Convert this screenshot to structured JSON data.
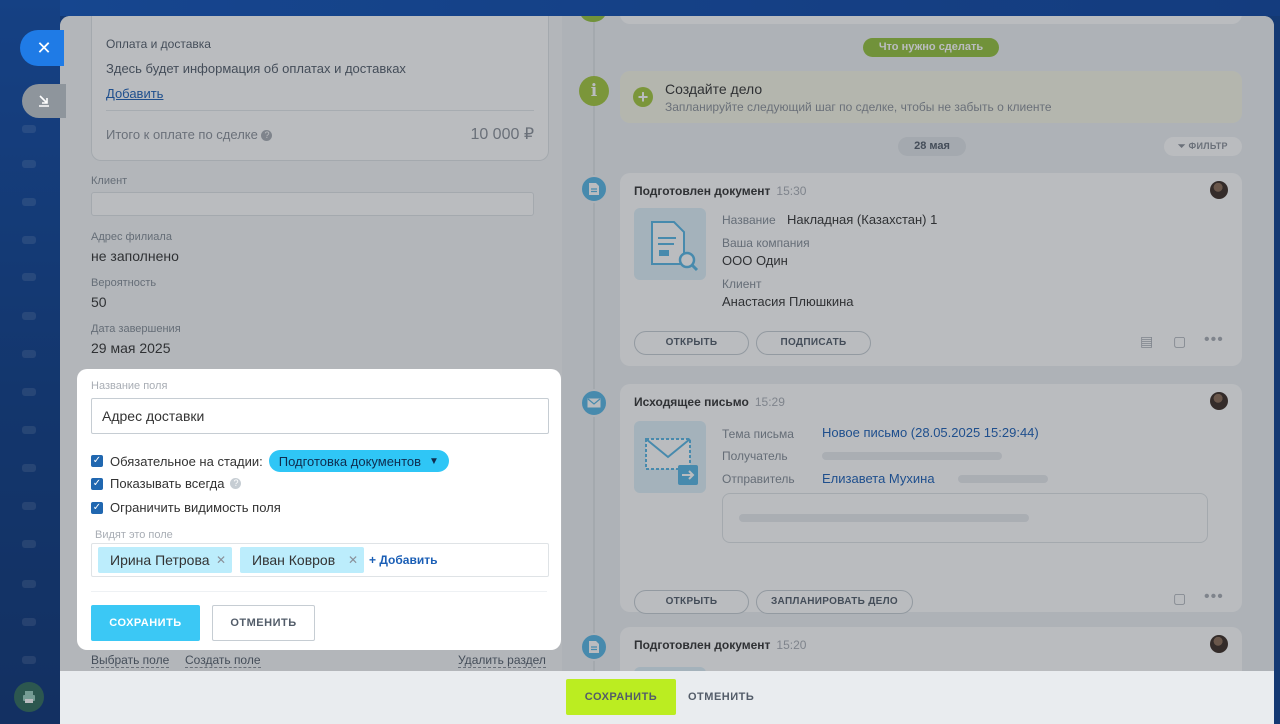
{
  "left_panel": {
    "payment": {
      "title": "Оплата и доставка",
      "description": "Здесь будет информация об оплатах и доставках",
      "add_link": "Добавить",
      "total_label": "Итого к оплате по сделке",
      "total_value": "10 000 ₽"
    },
    "fields": [
      {
        "label": "Клиент",
        "value": ""
      },
      {
        "label": "Адрес филиала",
        "value": "не заполнено"
      },
      {
        "label": "Вероятность",
        "value": "50"
      },
      {
        "label": "Дата завершения",
        "value": "29 мая 2025"
      }
    ],
    "bottom_links": {
      "choose_field": "Выбрать поле",
      "create_field": "Создать поле",
      "delete_section": "Удалить раздел"
    }
  },
  "timeline": {
    "todo_pill": "Что нужно сделать",
    "todo": {
      "title": "Создайте дело",
      "subtitle": "Запланируйте следующий шаг по сделке, чтобы не забыть о клиенте"
    },
    "date_pill": "28 мая",
    "filter_label": "ФИЛЬТР",
    "doc_card": {
      "title": "Подготовлен документ",
      "time": "15:30",
      "name_label": "Название",
      "name_value": "Накладная (Казахстан) 1",
      "company_label": "Ваша компания",
      "company_value": "ООО Один",
      "client_label": "Клиент",
      "client_value": "Анастасия Плюшкина",
      "open_btn": "ОТКРЫТЬ",
      "sign_btn": "ПОДПИСАТЬ"
    },
    "email_card": {
      "title": "Исходящее письмо",
      "time": "15:29",
      "subject_label": "Тема письма",
      "subject_value": "Новое письмо (28.05.2025 15:29:44)",
      "recipient_label": "Получатель",
      "sender_label": "Отправитель",
      "sender_value": "Елизавета Мухина",
      "open_btn": "ОТКРЫТЬ",
      "plan_btn": "ЗАПЛАНИРОВАТЬ ДЕЛО"
    },
    "doc_card2": {
      "title": "Подготовлен документ",
      "time": "15:20"
    }
  },
  "popup": {
    "field_name_label": "Название поля",
    "field_name_value": "Адрес доставки",
    "required_label": "Обязательное на стадии:",
    "stage_value": "Подготовка документов",
    "show_always_label": "Показывать всегда",
    "restrict_label": "Ограничить видимость поля",
    "visible_label": "Видят это поле",
    "users": [
      "Ирина Петрова",
      "Иван Ковров"
    ],
    "add_label": "+ Добавить",
    "save_btn": "СОХРАНИТЬ",
    "cancel_btn": "ОТМЕНИТЬ"
  },
  "bottom_bar": {
    "save_btn": "СОХРАНИТЬ",
    "cancel_btn": "ОТМЕНИТЬ"
  },
  "colors": {
    "accent_blue": "#3bc8f5",
    "stage_blue": "#2fc6f6",
    "green_pill": "#94c23c",
    "save_green": "#bbed21",
    "link_blue": "#1b5fb6"
  }
}
